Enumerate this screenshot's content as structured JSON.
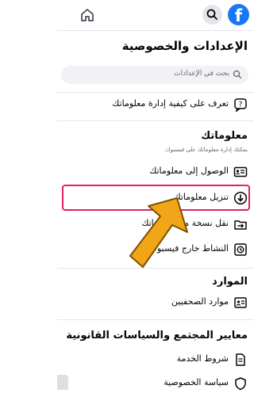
{
  "header": {
    "logo_letter": "f",
    "icons": {
      "logo": "facebook-logo-icon",
      "search": "search-icon",
      "home": "home-icon"
    }
  },
  "page": {
    "title": "الإعدادات والخصوصية"
  },
  "search": {
    "placeholder": "بحث في الإعدادات"
  },
  "help_item": {
    "label": "تعرف على كيفية إدارة معلوماتك",
    "icon": "help-question-icon"
  },
  "your_info": {
    "title": "معلوماتك",
    "subtitle": "يمكنك إدارة معلوماتك على فيسبوك.",
    "items": [
      {
        "label": "الوصول إلى معلوماتك",
        "icon": "id-card-icon"
      },
      {
        "label": "تنزيل معلوماتك",
        "icon": "download-icon"
      },
      {
        "label": "نقل نسخة من معلوماتك",
        "icon": "transfer-icon"
      },
      {
        "label": "النشاط خارج فيسبوك",
        "icon": "off-facebook-activity-icon"
      }
    ]
  },
  "resources": {
    "title": "الموارد",
    "items": [
      {
        "label": "موارد الصحفيين",
        "icon": "journalist-resources-icon"
      }
    ]
  },
  "legal": {
    "title": "معايير المجتمع والسياسات القانونية",
    "items": [
      {
        "label": "شروط الخدمة",
        "icon": "terms-icon"
      },
      {
        "label": "سياسة الخصوصية",
        "icon": "privacy-policy-icon"
      }
    ]
  },
  "colors": {
    "brand": "#1877f2",
    "highlight": "#e0245e",
    "arrow": "#f2a516",
    "divider": "#e4e6eb"
  }
}
